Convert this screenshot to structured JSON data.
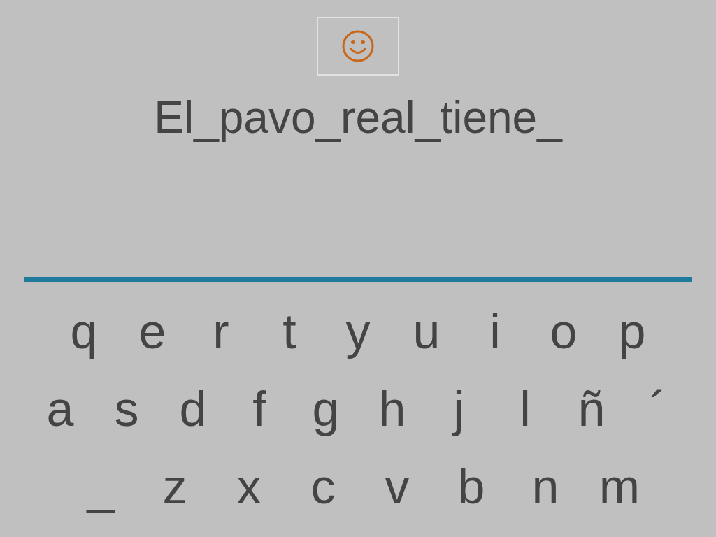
{
  "sentence": "El_pavo_real_tiene_",
  "keyboard": [
    [
      "q",
      "e",
      "r",
      "t",
      "y",
      "u",
      "i",
      "o",
      "p"
    ],
    [
      "a",
      "s",
      "d",
      "f",
      "g",
      "h",
      "j",
      "l",
      "ñ",
      "´"
    ],
    [
      "_",
      "z",
      "x",
      "c",
      "v",
      "b",
      "n",
      "m"
    ]
  ]
}
